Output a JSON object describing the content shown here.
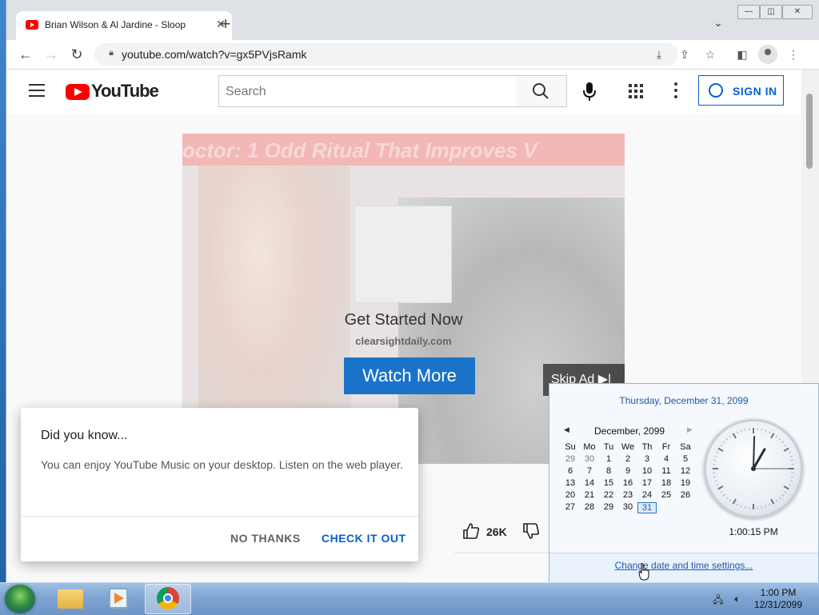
{
  "browser": {
    "tab_title": "Brian Wilson & Al Jardine - Sloop",
    "tab_close": "✕",
    "new_tab": "+",
    "url": "youtube.com/watch?v=gx5PVjsRamk",
    "window_buttons": [
      "▭",
      "◫",
      "✕"
    ]
  },
  "youtube": {
    "logo_text": "YouTube",
    "search_placeholder": "Search",
    "sign_in": "SIGN IN"
  },
  "ad": {
    "banner_text": "octor: 1 Odd Ritual That Improves V",
    "heading": "Get Started Now",
    "domain": "clearsightdaily.com",
    "cta": "Watch More",
    "skip": "Skip Ad ▶|"
  },
  "video": {
    "like_count": "26K"
  },
  "popup": {
    "title": "Did you know...",
    "body": "You can enjoy YouTube Music on your desktop. Listen on the web player.",
    "no_thanks": "NO THANKS",
    "check_it_out": "CHECK IT OUT"
  },
  "clock": {
    "full_date": "Thursday, December 31, 2099",
    "month_label": "December, 2099",
    "weekdays": [
      "Su",
      "Mo",
      "Tu",
      "We",
      "Th",
      "Fr",
      "Sa"
    ],
    "weeks": [
      [
        "29",
        "30",
        "1",
        "2",
        "3",
        "4",
        "5"
      ],
      [
        "6",
        "7",
        "8",
        "9",
        "10",
        "11",
        "12"
      ],
      [
        "13",
        "14",
        "15",
        "16",
        "17",
        "18",
        "19"
      ],
      [
        "20",
        "21",
        "22",
        "23",
        "24",
        "25",
        "26"
      ],
      [
        "27",
        "28",
        "29",
        "30",
        "31",
        "",
        ""
      ]
    ],
    "today": "31",
    "time": "1:00:15 PM",
    "hand_hour": 1,
    "hand_minute": 0,
    "hand_second": 15,
    "settings_link": "Change date and time settings..."
  },
  "taskbar": {
    "time": "1:00 PM",
    "date": "12/31/2099"
  }
}
